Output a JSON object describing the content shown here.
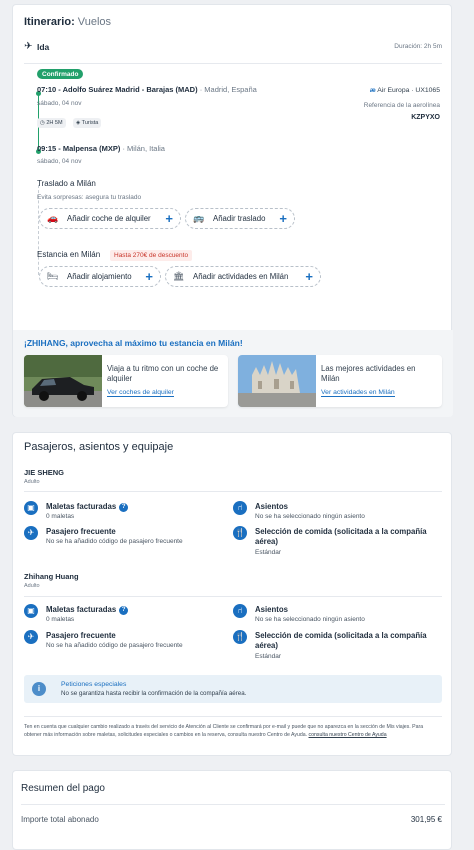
{
  "itinerary": {
    "title_bold": "Itinerario:",
    "title_sub": "Vuelos",
    "leg_label": "Ida",
    "duration": "Duración: 2h 5m",
    "status_badge": "Confirmado",
    "departure": {
      "time_airport": "07:10 - Adolfo Suárez Madrid - Barajas (MAD)",
      "city": "· Madrid, España",
      "date": "sábado, 04 nov",
      "chip_duration": "2H 5M",
      "chip_class": "Turista"
    },
    "airline": "Air Europa · UX1065",
    "ref_label": "Referencia de la aerolínea",
    "ref_code": "KZPYXO",
    "arrival": {
      "time_airport": "09:15 - Malpensa (MXP)",
      "city": "· Milán, Italia",
      "date": "sábado, 04 nov"
    },
    "transfer": {
      "title": "Traslado a Milán",
      "subtitle": "Evita sorpresas: asegura tu traslado",
      "btn_car": "Añadir coche de alquiler",
      "btn_transfer": "Añadir traslado"
    },
    "stay": {
      "title": "Estancia en Milán",
      "discount": "Hasta 270€ de descuento",
      "btn_lodging": "Añadir alojamiento",
      "btn_activities": "Añadir actividades en Milán"
    },
    "promo": {
      "title": "¡ZHIHANG, aprovecha al máximo tu estancia en Milán!",
      "card1_text": "Viaja a tu ritmo con un coche de alquiler",
      "card1_link": "Ver coches de alquiler",
      "card2_text": "Las mejores actividades en Milán",
      "card2_link": "Ver actividades en Milán"
    }
  },
  "passengers": {
    "title": "Pasajeros, asientos y equipaje",
    "list": [
      {
        "name": "JIE SHENG",
        "role": "Adulto",
        "bags_title": "Maletas facturadas",
        "bags_value": "0 maletas",
        "seats_title": "Asientos",
        "seats_value": "No se ha seleccionado ningún asiento",
        "ff_title": "Pasajero frecuente",
        "ff_value": "No se ha añadido código de pasajero frecuente",
        "meal_title": "Selección de comida (solicitada a la compañía aérea)",
        "meal_value": "Estándar"
      },
      {
        "name": "Zhihang Huang",
        "role": "Adulto",
        "bags_title": "Maletas facturadas",
        "bags_value": "0 maletas",
        "seats_title": "Asientos",
        "seats_value": "No se ha seleccionado ningún asiento",
        "ff_title": "Pasajero frecuente",
        "ff_value": "No se ha añadido código de pasajero frecuente",
        "meal_title": "Selección de comida (solicitada a la compañía aérea)",
        "meal_value": "Estándar"
      }
    ],
    "special_title": "Peticiones especiales",
    "special_text": "No se garantiza hasta recibir la confirmación de la compañía aérea.",
    "note": "Ten en cuenta que cualquier cambio realizado a través del servicio de Atención al Cliente se confirmará por e-mail y puede que no aparezca en la sección de Mis viajes. Para obtener más información sobre maletas, solicitudes especiales o cambios en la reserva, consulta nuestro Centro de Ayuda.",
    "note_link": "consulta nuestro Centro de Ayuda"
  },
  "payment": {
    "title": "Resumen del pago",
    "label": "Importe total abonado",
    "value": "301,95 €"
  }
}
